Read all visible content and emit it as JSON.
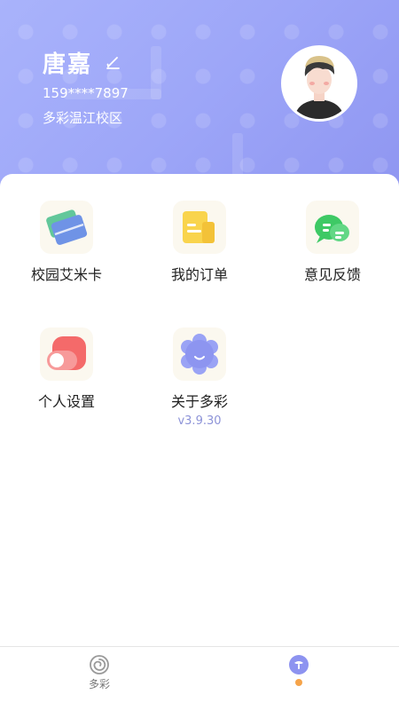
{
  "profile": {
    "name": "唐嘉",
    "phone": "159****7897",
    "campus": "多彩温江校区",
    "edit_icon": "edit-pen-icon",
    "avatar": "user-avatar"
  },
  "menu": {
    "items": [
      {
        "label": "校园艾米卡",
        "icon": "campus-card-icon"
      },
      {
        "label": "我的订单",
        "icon": "order-document-icon"
      },
      {
        "label": "意见反馈",
        "icon": "feedback-chat-icon"
      },
      {
        "label": "个人设置",
        "icon": "settings-toggle-icon"
      },
      {
        "label": "关于多彩",
        "icon": "about-flower-icon",
        "version": "v3.9.30"
      }
    ]
  },
  "tabbar": {
    "tabs": [
      {
        "label": "多彩",
        "icon": "spiral-home-icon",
        "active": false
      },
      {
        "label": "",
        "icon": "mine-icon",
        "active": true,
        "badge": "dot"
      }
    ]
  },
  "colors": {
    "header_gradient_start": "#a9b3fb",
    "header_gradient_end": "#8f96f1",
    "accent": "#8d93d8",
    "badge": "#f6a44a",
    "card_yellow": "#f9d44d",
    "feedback_green": "#3ec965",
    "toggle_red": "#f46a6a"
  }
}
